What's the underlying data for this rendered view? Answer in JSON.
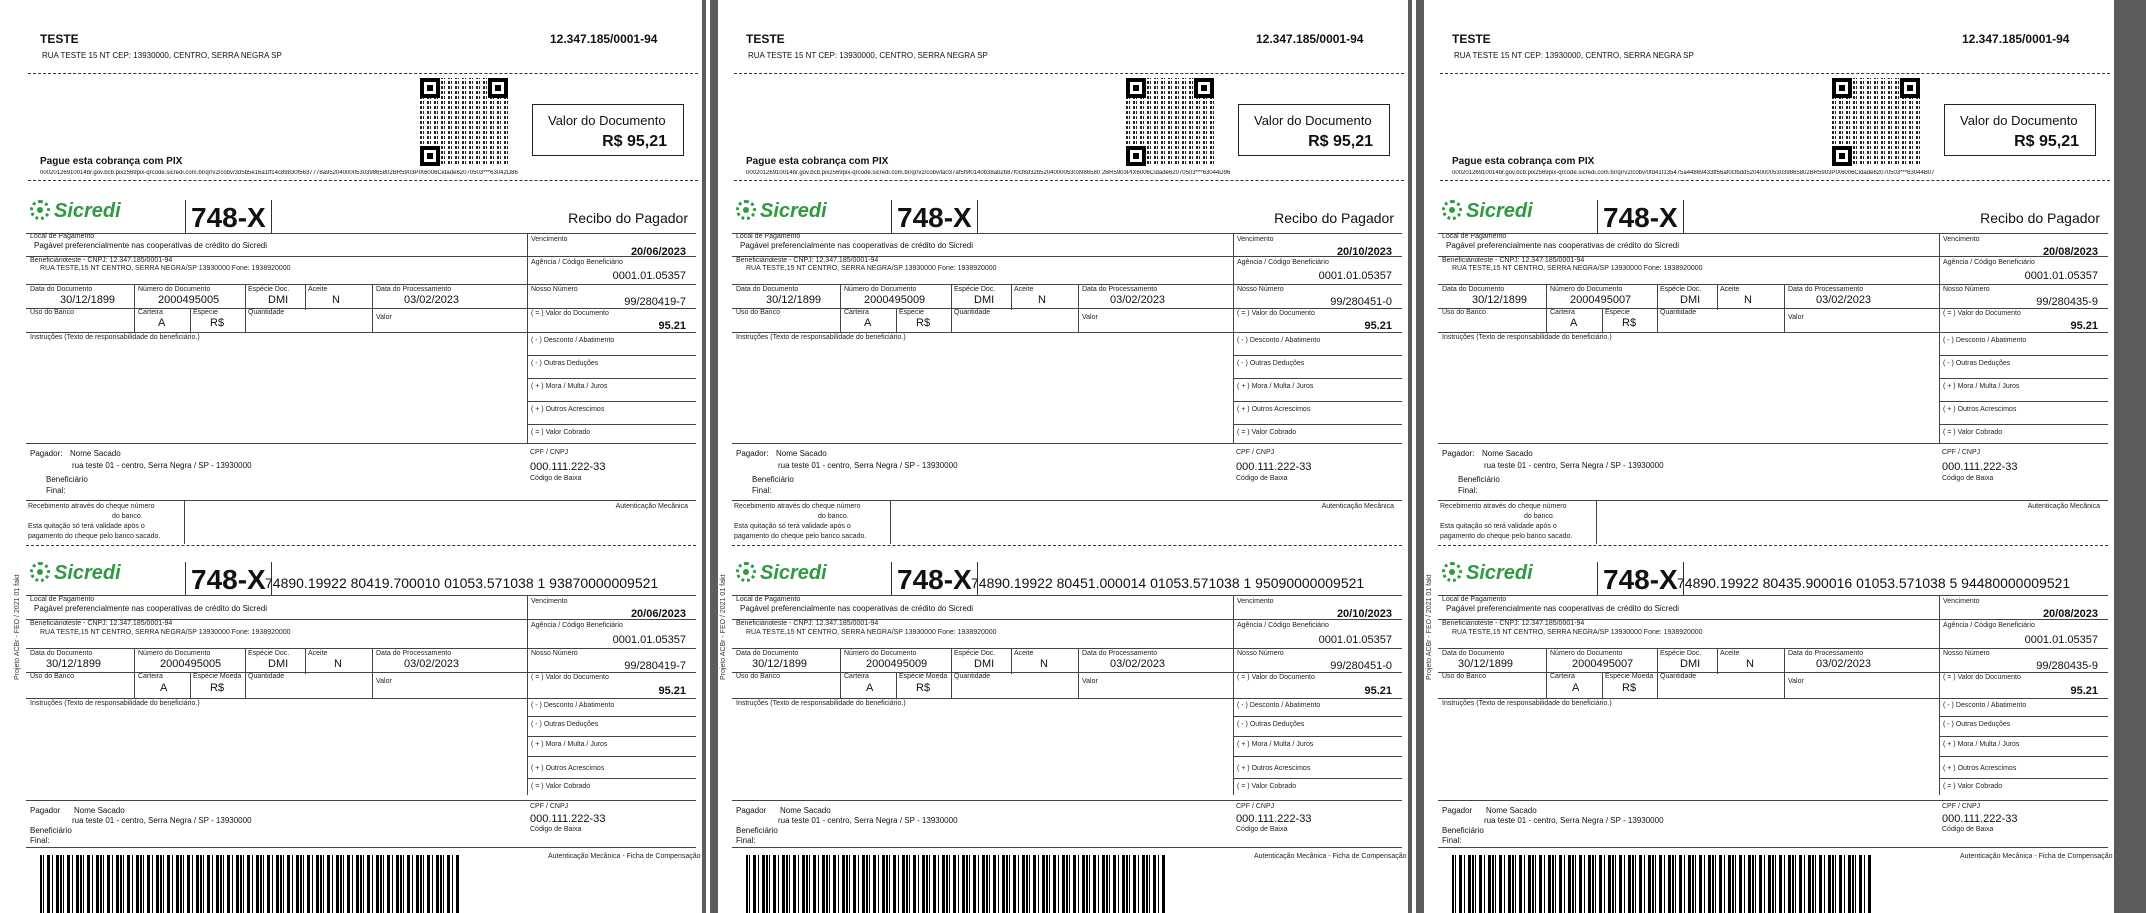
{
  "common": {
    "cedente_name": "TESTE",
    "cnpj": "12.347.185/0001-94",
    "address": "RUA TESTE 15 NT  CEP: 13930000,  CENTRO, SERRA NEGRA SP",
    "valor_documento_label": "Valor do Documento",
    "valor_documento": "R$ 95,21",
    "pix_label": "Pague esta cobrança com PIX",
    "bank_code": "748-X",
    "bank_name": "Sicredi",
    "recibo_label": "Recibo do Pagador",
    "local_pagamento_label": "Local de Pagamento",
    "local_pagamento": "Pagável preferencialmente nas cooperativas de crédito do Sicredi",
    "vencimento_label": "Vencimento",
    "beneficiario_label": "Beneficiário",
    "beneficiario_top": "teste - CNPJ: 12.347.185/0001-94",
    "beneficiario_addr_top": "RUA TESTE,15 NT CENTRO, SERRA NEGRA/SP 13930000 Fone: 1938920000",
    "beneficiario_addr_bottom": "RUA TESTE,15 NT CENTRO, SERRA NEGRA/SP 13930000 Fone: 1938920000",
    "agencia_label_a": "Agência / Código Beneficiário",
    "agencia_label_b": "Agência / Códiga Beneficiário",
    "agencia": "0001.01.05357",
    "data_documento_label": "Data do Documento",
    "data_documento": "30/12/1899",
    "numero_documento_label": "Número do Documento",
    "especie_doc_label": "Espécie Doc.",
    "especie_doc": "DMI",
    "aceite_label": "Aceite",
    "aceite": "N",
    "data_processamento_label": "Data do Processamento",
    "data_processamento": "03/02/2023",
    "nosso_numero_label": "Nosso Número",
    "uso_banco_label": "Uso do Banco",
    "carteira_label": "Carteira",
    "carteira": "A",
    "especie_label": "Especie",
    "especie_moeda_label": "Espécie Moeda",
    "especie": "R$",
    "quantidade_label": "Quantidade",
    "valor_label": "Valor",
    "valor_doc_label": "( = ) Valor do Documento",
    "valor_doc": "95.21",
    "desconto_label": "( - ) Desconto / Abatimento",
    "outras_deducoes_label": "( - ) Outras Deduções",
    "mora_label": "( + ) Mora / Multa / Juros",
    "outros_acrescimos_label": "( + ) Outros Acrescimos",
    "valor_cobrado_label": "( = ) Valor Cobrado",
    "instrucoes_label": "Instruções (Texto de responsabilidade do beneficiário.)",
    "pagador_label": "Pagador:",
    "pagador_label2": "Pagador",
    "pagador_nome": "Nome Sacado",
    "pagador_endereco": "rua teste 01  - centro, Serra Negra / SP - 13930000",
    "beneficiario_final_label": "Beneficiário",
    "final_label": "Final:",
    "cpf_label": "CPF / CNPJ",
    "cpf": "000.111.222-33",
    "codigo_baixa_label": "Código de Baixa",
    "recebimento_1": "Recebimento através do cheque número",
    "recebimento_2": "do banco.",
    "recebimento_3": "Esta quitação só terá validade após o",
    "recebimento_4": "pagamento do cheque pelo banco sacado.",
    "autenticacao_label": "Autenticação Mecânica",
    "autenticacao_ficha": "Autenticação Mecânica - Ficha de Compensação",
    "side_text": "Projeto ACBr - FEO / 2021 01 fakt"
  },
  "boletos": [
    {
      "pix_code": "00020126910014br.gov.bcb.pix2569pix-qrcode.sicredi.com.br/qr/v2/cobv/3d5b5e16a1ff14c89830f5637778a95204000053039865802BR5903PIX6006Cidade62070503***63042D86",
      "vencimento": "20/06/2023",
      "numero_documento": "2000495005",
      "nosso_numero": "99/280419-7",
      "linha_digitavel": "74890.19922 80419.700010 01053.571038 1 93870000009521"
    },
    {
      "pix_code": "00020126910014br.gov.bcb.pix2569pix-qrcode.sicredi.com.br/qr/v2/cobv/la037af5f9f0140b38ab2b87f0cf8d32b520400005303986580 2BR5903PIX6006Cidade62070503***63044D96",
      "vencimento": "20/10/2023",
      "numero_documento": "2000495009",
      "nosso_numero": "99/280451-0",
      "linha_digitavel": "74890.19922 80451.000014 01053.571038 1 95090000009521"
    },
    {
      "pix_code": "00020126910014br.gov.bcb.pix2569pix-qrcode.sicredi.com.br/qr/v2/cobv/0fd41f135475a44869433ff56af0cfbdd5204000053039865802BR5903PIX6006Cidade62070503***63044B07",
      "vencimento": "20/08/2023",
      "numero_documento": "2000495007",
      "nosso_numero": "99/280435-9",
      "linha_digitavel": "74890.19922 80435.900016 01053.571038 5 94480000009521"
    }
  ]
}
